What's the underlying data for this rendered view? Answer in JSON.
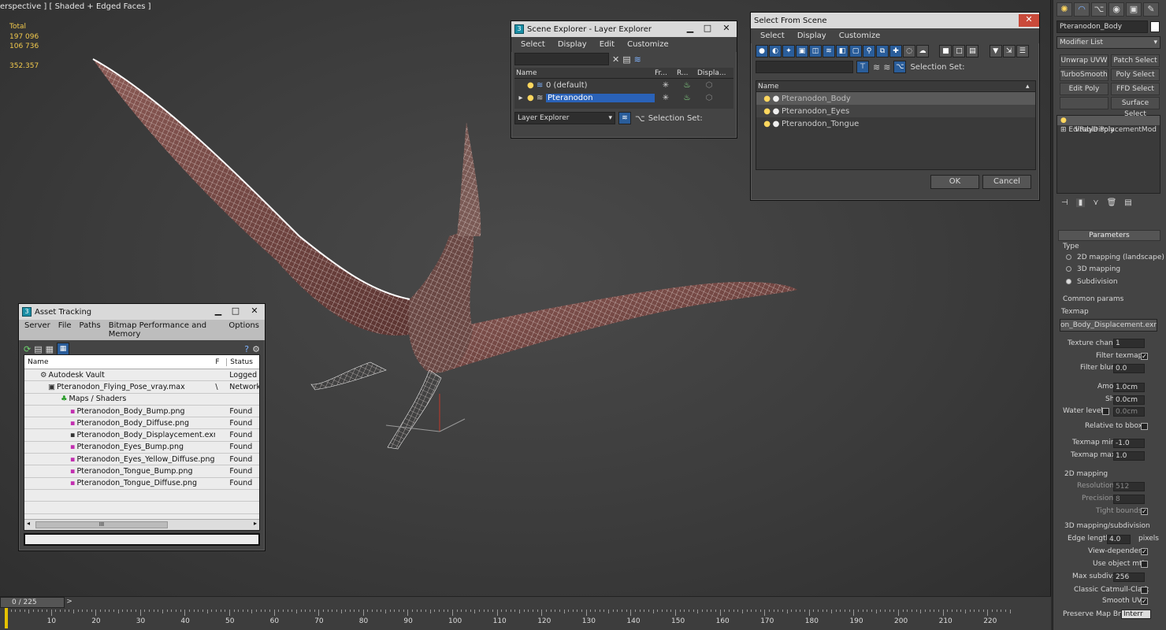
{
  "viewport": {
    "label": "erspective ] [ Shaded + Edged Faces ]",
    "stats": {
      "total_label": "Total",
      "polys": "197 096",
      "verts": "106 736",
      "fps": "352.357"
    }
  },
  "layer_explorer": {
    "title": "Scene Explorer - Layer Explorer",
    "menu": [
      "Select",
      "Display",
      "Edit",
      "Customize"
    ],
    "columns": [
      "Name",
      "Fr...",
      "R...",
      "Displa..."
    ],
    "layers": [
      "0 (default)",
      "Pteranodon"
    ],
    "footer_dropdown": "Layer Explorer",
    "selection_set_label": "Selection Set:"
  },
  "select_from_scene": {
    "title": "Select From Scene",
    "menu": [
      "Select",
      "Display",
      "Customize"
    ],
    "selection_set_label": "Selection Set:",
    "column": "Name",
    "items": [
      "Pteranodon_Body",
      "Pteranodon_Eyes",
      "Pteranodon_Tongue"
    ],
    "ok": "OK",
    "cancel": "Cancel"
  },
  "asset_tracking": {
    "title": "Asset Tracking",
    "menu": [
      "Server",
      "File",
      "Paths",
      "Bitmap Performance and Memory",
      "Options"
    ],
    "columns": [
      "Name",
      "F",
      "Status"
    ],
    "rows": [
      {
        "name": "Autodesk Vault",
        "f": "",
        "status": "Logged"
      },
      {
        "name": "Pteranodon_Flying_Pose_vray.max",
        "f": "\\",
        "status": "Network"
      },
      {
        "name": "Maps / Shaders",
        "f": "",
        "status": ""
      },
      {
        "name": "Pteranodon_Body_Bump.png",
        "f": "",
        "status": "Found"
      },
      {
        "name": "Pteranodon_Body_Diffuse.png",
        "f": "",
        "status": "Found"
      },
      {
        "name": "Pteranodon_Body_Displaycement.exr",
        "f": "",
        "status": "Found"
      },
      {
        "name": "Pteranodon_Eyes_Bump.png",
        "f": "",
        "status": "Found"
      },
      {
        "name": "Pteranodon_Eyes_Yellow_Diffuse.png",
        "f": "",
        "status": "Found"
      },
      {
        "name": "Pteranodon_Tongue_Bump.png",
        "f": "",
        "status": "Found"
      },
      {
        "name": "Pteranodon_Tongue_Diffuse.png",
        "f": "",
        "status": "Found"
      }
    ],
    "scroll_thumb": "III"
  },
  "command_panel": {
    "object_name": "Pteranodon_Body",
    "modifier_list": "Modifier List",
    "mod_buttons": [
      "Unwrap UVW",
      "Patch Select",
      "TurboSmooth",
      "Poly Select",
      "Edit Poly",
      "FFD Select",
      "",
      "Surface Select"
    ],
    "stack": [
      "VRayDisplacementMod",
      "Editable Poly"
    ],
    "parameters_title": "Parameters",
    "type_label": "Type",
    "types": [
      "2D mapping (landscape)",
      "3D mapping",
      "Subdivision"
    ],
    "common_params": "Common params",
    "texmap_label": "Texmap",
    "texmap_value": "on_Body_Displacement.exr)",
    "texture_chan_label": "Texture chan",
    "texture_chan": "1",
    "filter_texmap": "Filter texmap",
    "filter_blur_label": "Filter blur",
    "filter_blur": "0.0",
    "amount_label": "Amount",
    "amount": "1.0cm",
    "shift_label": "Shift",
    "shift": "0.0cm",
    "water_level_label": "Water level",
    "water_level": "0.0cm",
    "relative_bbox": "Relative to bbox",
    "texmap_min_label": "Texmap min",
    "texmap_min": "-1.0",
    "texmap_max_label": "Texmap max",
    "texmap_max": "1.0",
    "mapping_2d": "2D mapping",
    "resolution_label": "Resolution",
    "resolution": "512",
    "precision_label": "Precision",
    "precision": "8",
    "tight_bounds": "Tight bounds",
    "mapping_3d": "3D mapping/subdivision",
    "edge_length_label": "Edge length",
    "edge_length": "4.0",
    "pixels": "pixels",
    "view_dependent": "View-dependent",
    "use_object_mtl": "Use object mtl",
    "max_subdivs_label": "Max subdivs",
    "max_subdivs": "256",
    "classic_catmull": "Classic Catmull-Clark",
    "smooth_uvs": "Smooth UVs",
    "preserve_map_bnd": "Preserve Map Bnd",
    "preserve_value": "Interr"
  },
  "timeline": {
    "frame": "0 / 225",
    "next": ">",
    "ticks": [
      "10",
      "20",
      "30",
      "40",
      "50",
      "60",
      "70",
      "80",
      "90",
      "100",
      "110",
      "120",
      "130",
      "140",
      "150",
      "160",
      "170",
      "180",
      "190",
      "200",
      "210",
      "220"
    ]
  }
}
